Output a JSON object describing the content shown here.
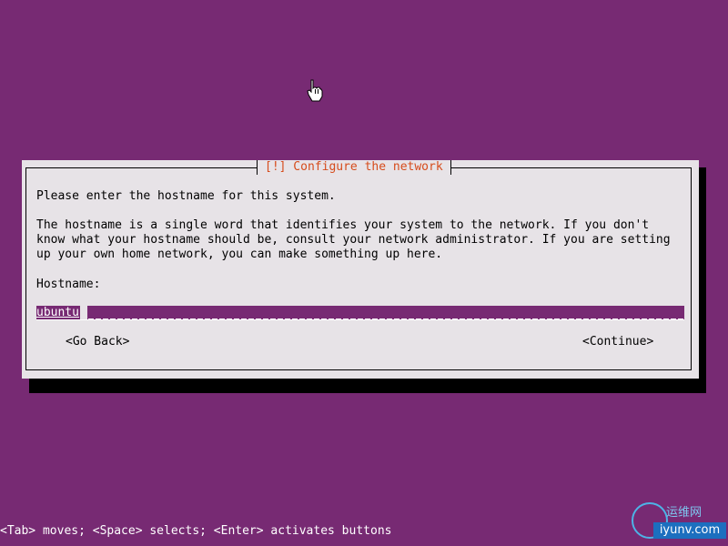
{
  "dialog": {
    "title": "[!] Configure the network",
    "intro": "Please enter the hostname for this system.",
    "description_lines": [
      "The hostname is a single word that identifies your system to the network. If you don't",
      "know what your hostname should be, consult your network administrator. If you are setting",
      "up your own home network, you can make something up here."
    ],
    "field_label": "Hostname:",
    "hostname_value": "ubuntu",
    "back_button": "<Go Back>",
    "continue_button": "<Continue>"
  },
  "status_bar": {
    "text": "<Tab> moves; <Space> selects; <Enter> activates buttons"
  },
  "watermark": {
    "chinese": "运维网",
    "domain": "iyunv.com"
  },
  "colors": {
    "background": "#772a73",
    "dialog": "#e7e3e7",
    "title": "#d64c1c"
  },
  "icons": {
    "cursor": "hand-pointer-icon"
  }
}
